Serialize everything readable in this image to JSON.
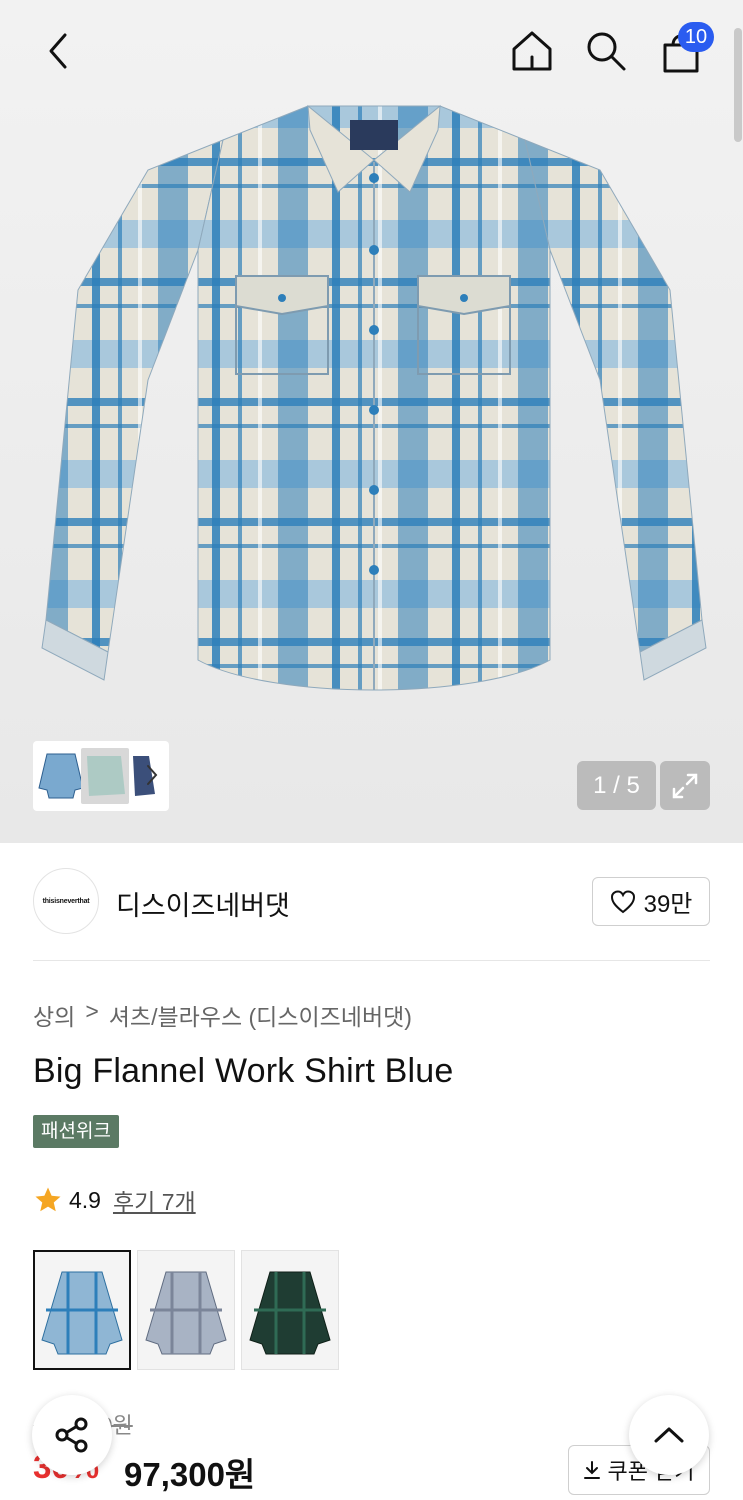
{
  "header": {
    "cart_count": "10"
  },
  "gallery": {
    "counter": "1 / 5"
  },
  "brand": {
    "logo_text": "thisisneverthat",
    "name": "디스이즈네버댓",
    "likes": "39만"
  },
  "product": {
    "breadcrumb": [
      "상의",
      "셔츠/블라우스 (디스이즈네버댓)"
    ],
    "title": "Big Flannel Work Shirt Blue",
    "tag": "패션위크",
    "rating": "4.9",
    "review_link": "후기 7개",
    "variants": [
      "blue",
      "grey",
      "green"
    ]
  },
  "price": {
    "original": "139,000원",
    "discount": "30%",
    "sale": "97,300원",
    "coupon_label": "쿠폰 받기"
  },
  "colors": {
    "accent": "#2a5cf0",
    "discount": "#e8302f",
    "tag_bg": "#5b7a64",
    "star": "#f5a623"
  }
}
